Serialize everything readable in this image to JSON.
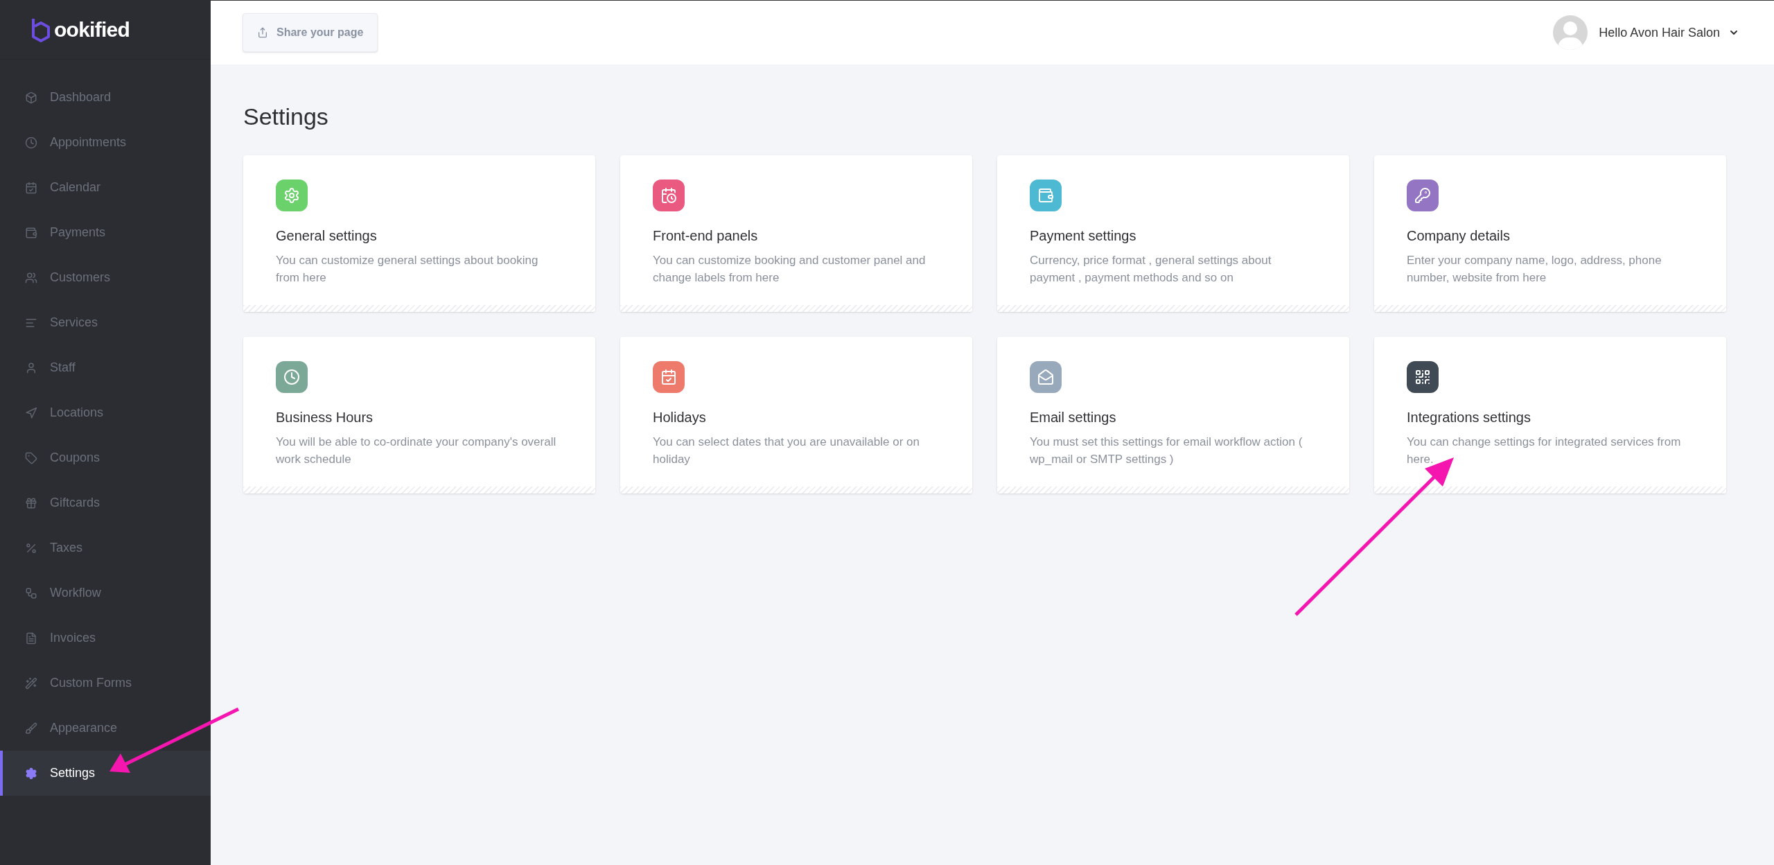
{
  "sidebar": {
    "logo": "ookified",
    "items": [
      {
        "label": "Dashboard",
        "selected": false
      },
      {
        "label": "Appointments",
        "selected": false
      },
      {
        "label": "Calendar",
        "selected": false
      },
      {
        "label": "Payments",
        "selected": false
      },
      {
        "label": "Customers",
        "selected": false
      },
      {
        "label": "Services",
        "selected": false
      },
      {
        "label": "Staff",
        "selected": false
      },
      {
        "label": "Locations",
        "selected": false
      },
      {
        "label": "Coupons",
        "selected": false
      },
      {
        "label": "Giftcards",
        "selected": false
      },
      {
        "label": "Taxes",
        "selected": false
      },
      {
        "label": "Workflow",
        "selected": false
      },
      {
        "label": "Invoices",
        "selected": false
      },
      {
        "label": "Custom Forms",
        "selected": false
      },
      {
        "label": "Appearance",
        "selected": false
      },
      {
        "label": "Settings",
        "selected": true
      }
    ]
  },
  "topbar": {
    "share_button": "Share your page",
    "user": "Hello Avon Hair Salon"
  },
  "page_title": "Settings",
  "cards": [
    {
      "title": "General settings",
      "description": "You can customize general settings about booking from here",
      "color": "#6bd16a"
    },
    {
      "title": "Front-end panels",
      "description": "You can customize booking and customer panel and change labels from here",
      "color": "#ea5a80"
    },
    {
      "title": "Payment settings",
      "description": "Currency, price format , general settings about payment , payment methods and so on",
      "color": "#4db9d3"
    },
    {
      "title": "Company details",
      "description": "Enter your company name, logo, address, phone number, website from here",
      "color": "#9475c3"
    },
    {
      "title": "Business Hours",
      "description": "You will be able to co-ordinate your company's overall work schedule",
      "color": "#7ca897"
    },
    {
      "title": "Holidays",
      "description": "You can select dates that you are unavailable or on holiday",
      "color": "#ee7a6c"
    },
    {
      "title": "Email settings",
      "description": "You must set this settings for email workflow action ( wp_mail or SMTP settings )",
      "color": "#98a9bb"
    },
    {
      "title": "Integrations settings",
      "description": "You can change settings for integrated services from here.",
      "color": "#3f4a55"
    }
  ]
}
